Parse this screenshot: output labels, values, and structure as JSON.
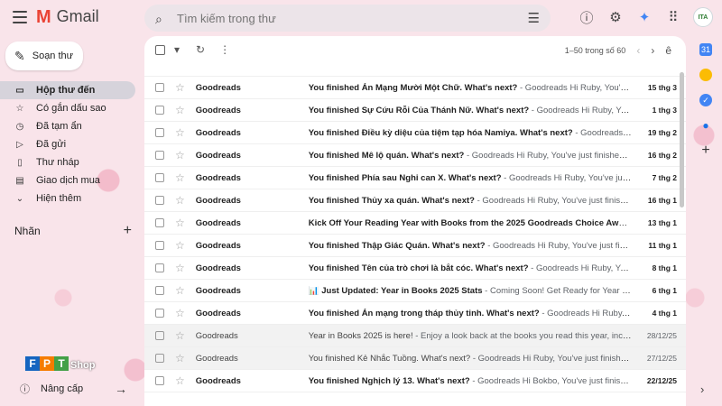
{
  "app": {
    "logo_letter": "M",
    "name": "Gmail"
  },
  "search": {
    "placeholder": "Tìm kiếm trong thư"
  },
  "sidebar": {
    "compose_label": "Soạn thư",
    "items": [
      {
        "label": "Hộp thư đến",
        "icon": "inbox-icon",
        "active": true
      },
      {
        "label": "Có gắn dấu sao",
        "icon": "star-icon",
        "active": false
      },
      {
        "label": "Đã tạm ẩn",
        "icon": "clock-icon",
        "active": false
      },
      {
        "label": "Đã gửi",
        "icon": "send-icon",
        "active": false
      },
      {
        "label": "Thư nháp",
        "icon": "draft-icon",
        "active": false
      },
      {
        "label": "Giao dịch mua",
        "icon": "purchase-icon",
        "active": false
      },
      {
        "label": "Hiện thêm",
        "icon": "chevron-down-icon",
        "active": false
      }
    ],
    "labels_heading": "Nhãn",
    "upgrade_label": "Nâng cấp",
    "brand": {
      "letters": [
        "F",
        "P",
        "T"
      ],
      "shop": "Shop",
      "colors": [
        "#1565c0",
        "#f57c00",
        "#43a047"
      ]
    }
  },
  "toolbar": {
    "pagination": "1–50 trong số 60",
    "language_icon": "ê"
  },
  "emails": [
    {
      "sender": "Goodreads",
      "subject": "You finished Án Mạng Mười Một Chữ. What's next?",
      "snippet": " - Goodreads Hi Ruby, You've just fi...",
      "date": "15 thg 3",
      "read": false
    },
    {
      "sender": "Goodreads",
      "subject": "You finished Sự Cứu Rỗi Của Thánh Nữ. What's next?",
      "snippet": " - Goodreads Hi Ruby, You've just ...",
      "date": "1 thg 3",
      "read": false
    },
    {
      "sender": "Goodreads",
      "subject": "You finished Điều kỳ diệu của tiệm tạp hóa Namiya. What's next?",
      "snippet": " - Goodreads Hi R...",
      "date": "19 thg 2",
      "read": false
    },
    {
      "sender": "Goodreads",
      "subject": "You finished Mê lộ quán. What's next?",
      "snippet": " - Goodreads Hi Ruby, You've just finished Mê l...",
      "date": "16 thg 2",
      "read": false
    },
    {
      "sender": "Goodreads",
      "subject": "You finished Phía sau Nghi can X. What's next?",
      "snippet": " - Goodreads Hi Ruby, You've just finis...",
      "date": "7 thg 2",
      "read": false
    },
    {
      "sender": "Goodreads",
      "subject": "You finished Thủy xa quán. What's next?",
      "snippet": " - Goodreads Hi Ruby, You've just finished T...",
      "date": "16 thg 1",
      "read": false
    },
    {
      "sender": "Goodreads",
      "subject": "Kick Off Your Reading Year with Books from the 2025 Goodreads Choice Awards",
      "snippet": " - N",
      "date": "13 thg 1",
      "read": false
    },
    {
      "sender": "Goodreads",
      "subject": "You finished Thập Giác Quán. What's next?",
      "snippet": " - Goodreads Hi Ruby, You've just finished...",
      "date": "11 thg 1",
      "read": false
    },
    {
      "sender": "Goodreads",
      "subject": "You finished Tên của trò chơi là bắt cóc. What's next?",
      "snippet": " - Goodreads Hi Ruby, You've just...",
      "date": "8 thg 1",
      "read": false
    },
    {
      "sender": "Goodreads",
      "subject": "📊 Just Updated: Year in Books 2025 Stats",
      "snippet": " - Coming Soon! Get Ready for Year in Bo...",
      "date": "6 thg 1",
      "read": false
    },
    {
      "sender": "Goodreads",
      "subject": "You finished Án mạng trong tháp thủy tinh. What's next?",
      "snippet": " - Goodreads Hi Ruby, You'...",
      "date": "4 thg 1",
      "read": false
    },
    {
      "sender": "Goodreads",
      "subject": "Year in Books 2025 is here!",
      "snippet": " - Enjoy a look back at the books you read this year, including...",
      "date": "28/12/25",
      "read": true
    },
    {
      "sender": "Goodreads",
      "subject": "You finished Kẻ Nhắc Tuồng. What's next?",
      "snippet": " - Goodreads Hi Ruby, You've just finished Kẻ ...",
      "date": "27/12/25",
      "read": true
    },
    {
      "sender": "Goodreads",
      "subject": "You finished Nghịch lý 13. What's next?",
      "snippet": " - Goodreads Hi Bokbo, You've just finished...",
      "date": "22/12/25",
      "read": false
    }
  ]
}
